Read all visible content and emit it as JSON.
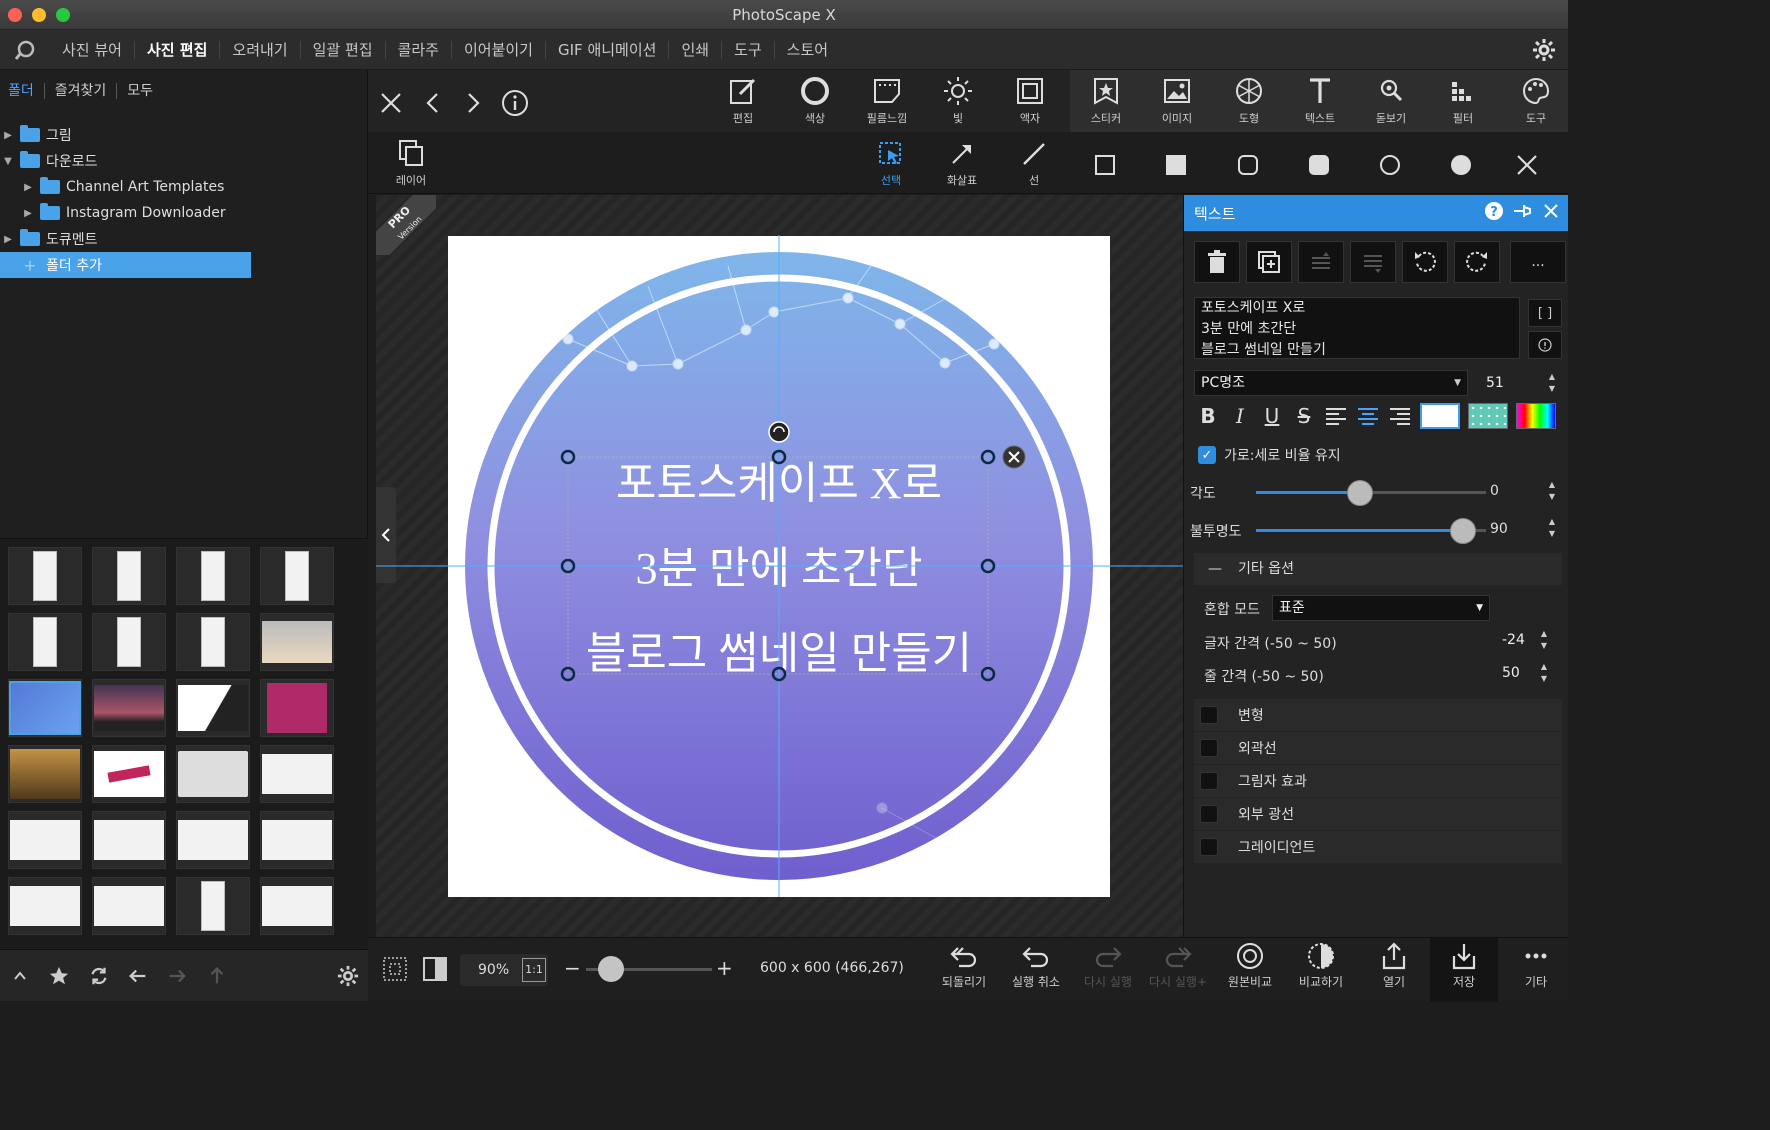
{
  "window": {
    "title": "PhotoScape X"
  },
  "menu": {
    "items": [
      "사진 뷰어",
      "사진 편집",
      "오려내기",
      "일괄 편집",
      "콜라주",
      "이어붙이기",
      "GIF 애니메이션",
      "인쇄",
      "도구",
      "스토어"
    ],
    "active": "사진 편집"
  },
  "left_tabs": [
    "폴더",
    "즐겨찾기",
    "모두"
  ],
  "tree": {
    "pictures": "그림",
    "downloads": "다운로드",
    "channel_art": "Channel Art Templates",
    "instagram": "Instagram Downloader",
    "documents": "도큐멘트",
    "add_folder": "폴더 추가"
  },
  "toolbar": {
    "edit": "편집",
    "color": "색상",
    "film": "필름느낌",
    "light": "빛",
    "frame": "액자",
    "sticker": "스티커",
    "image": "이미지",
    "shape": "도형",
    "text": "텍스트",
    "magnifier": "돋보기",
    "filter": "필터",
    "tools": "도구"
  },
  "subbar": {
    "layer": "레이어",
    "select": "선택",
    "arrow": "화살표",
    "line": "선"
  },
  "badge": {
    "pro": "PRO",
    "version": "Version"
  },
  "canvas_text": [
    "포토스케이프 X로",
    "3분 만에 초간단",
    "블로그 썸네일 만들기"
  ],
  "colors": {
    "circle_top": "#7fb6ea",
    "circle_bottom": "#6f5fce",
    "accent": "#2f8de0"
  },
  "panel": {
    "title": "텍스트",
    "text_lines": [
      "포토스케이프 X로",
      "3분 만에 초간단",
      "블로그 썸네일 만들기"
    ],
    "bracket_btn": "[ ]",
    "font": "PC명조",
    "font_size": "51",
    "keep_ratio": "가로:세로 비율 유지",
    "angle_label": "각도",
    "angle_value": "0",
    "angle_pct": 0.45,
    "opacity_label": "불투명도",
    "opacity_value": "90",
    "opacity_pct": 0.9,
    "more_options": "기타 옵션",
    "blend_label": "혼합 모드",
    "blend_value": "표준",
    "letter_spacing_label": "글자 간격 (-50 ~ 50)",
    "letter_spacing_value": "-24",
    "line_spacing_label": "줄 간격 (-50 ~ 50)",
    "line_spacing_value": "50",
    "effects": [
      "변형",
      "외곽선",
      "그림자 효과",
      "외부 광선",
      "그레이디언트"
    ]
  },
  "bottom": {
    "zoom": "90%",
    "one_to_one": "1:1",
    "dimensions": "600 x 600 (466,267)",
    "undo_all": "되돌리기",
    "undo": "실행 취소",
    "redo": "다시 실행",
    "redo_all": "다시 실행+",
    "compare_original": "원본비교",
    "compare": "비교하기",
    "open": "열기",
    "save": "저장",
    "more": "기타"
  }
}
